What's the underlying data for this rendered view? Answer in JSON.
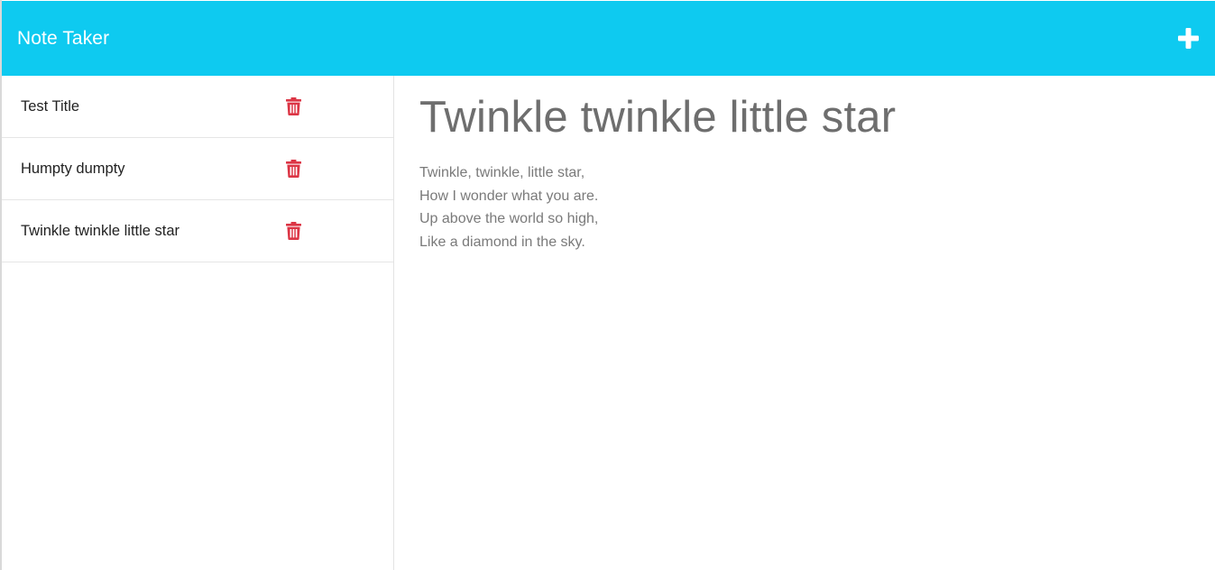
{
  "header": {
    "title": "Note Taker",
    "new_note_icon": "plus-icon",
    "bg_color": "#0ecaf0"
  },
  "notes": [
    {
      "title": "Test Title",
      "delete_icon": "trash-icon"
    },
    {
      "title": "Humpty dumpty",
      "delete_icon": "trash-icon"
    },
    {
      "title": "Twinkle twinkle little star",
      "delete_icon": "trash-icon"
    }
  ],
  "active_note": {
    "title": "Twinkle twinkle little star",
    "body_lines": [
      "Twinkle, twinkle, little star,",
      "How I wonder what you are.",
      "Up above the world so high,",
      "Like a diamond in the sky."
    ]
  },
  "colors": {
    "delete": "#dc3545"
  }
}
